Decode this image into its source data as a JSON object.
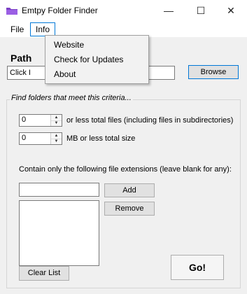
{
  "window": {
    "title": "Emtpy Folder Finder",
    "minimize_glyph": "—",
    "maximize_glyph": "☐",
    "close_glyph": "✕"
  },
  "menubar": {
    "items": [
      {
        "label": "File"
      },
      {
        "label": "Info"
      }
    ]
  },
  "info_menu": {
    "items": [
      {
        "label": "Website"
      },
      {
        "label": "Check for Updates"
      },
      {
        "label": "About"
      }
    ]
  },
  "path": {
    "label": "Path",
    "value": "Click I",
    "browse_label": "Browse"
  },
  "criteria": {
    "title": "Find folders that meet this criteria...",
    "files_value": "0",
    "files_label": "or less total files (including files in subdirectories)",
    "size_value": "0",
    "size_label": "MB or less total size",
    "ext_label": "Contain only the following file extensions (leave blank for any):",
    "ext_value": "",
    "add_label": "Add",
    "remove_label": "Remove",
    "clear_label": "Clear List"
  },
  "go_label": "Go!",
  "colors": {
    "accent": "#0078d7",
    "icon": "#7b3fc4"
  }
}
